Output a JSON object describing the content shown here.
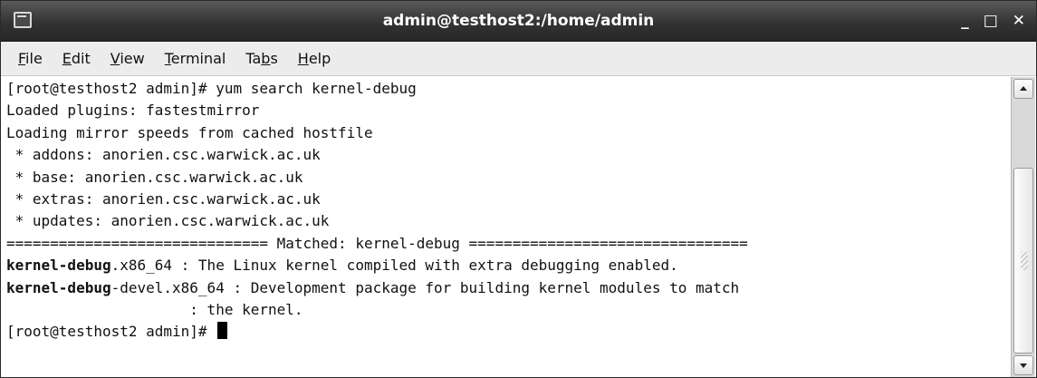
{
  "window": {
    "title": "admin@testhost2:/home/admin",
    "app_icon": "terminal-icon",
    "controls": {
      "minimize": "_",
      "maximize": "□",
      "close": "✕"
    }
  },
  "menu": {
    "items": [
      {
        "mnemonic": "F",
        "rest": "ile"
      },
      {
        "mnemonic": "E",
        "rest": "dit"
      },
      {
        "mnemonic": "V",
        "rest": "iew"
      },
      {
        "mnemonic": "T",
        "rest": "erminal"
      },
      {
        "pre": "Ta",
        "mnemonic": "b",
        "rest": "s"
      },
      {
        "mnemonic": "H",
        "rest": "elp"
      }
    ]
  },
  "terminal": {
    "lines": [
      {
        "text": "[root@testhost2 admin]# yum search kernel-debug"
      },
      {
        "text": "Loaded plugins: fastestmirror"
      },
      {
        "text": "Loading mirror speeds from cached hostfile"
      },
      {
        "text": " * addons: anorien.csc.warwick.ac.uk"
      },
      {
        "text": " * base: anorien.csc.warwick.ac.uk"
      },
      {
        "text": " * extras: anorien.csc.warwick.ac.uk"
      },
      {
        "text": " * updates: anorien.csc.warwick.ac.uk"
      },
      {
        "text": "============================== Matched: kernel-debug ================================"
      },
      {
        "bold": "kernel-debug",
        "text": ".x86_64 : The Linux kernel compiled with extra debugging enabled."
      },
      {
        "bold": "kernel-debug",
        "text": "-devel.x86_64 : Development package for building kernel modules to match"
      },
      {
        "text": "                     : the kernel."
      },
      {
        "text": "[root@testhost2 admin]# ",
        "cursor": true
      }
    ]
  },
  "scrollbar": {
    "up_icon": "arrow-up-icon",
    "down_icon": "arrow-down-icon"
  }
}
